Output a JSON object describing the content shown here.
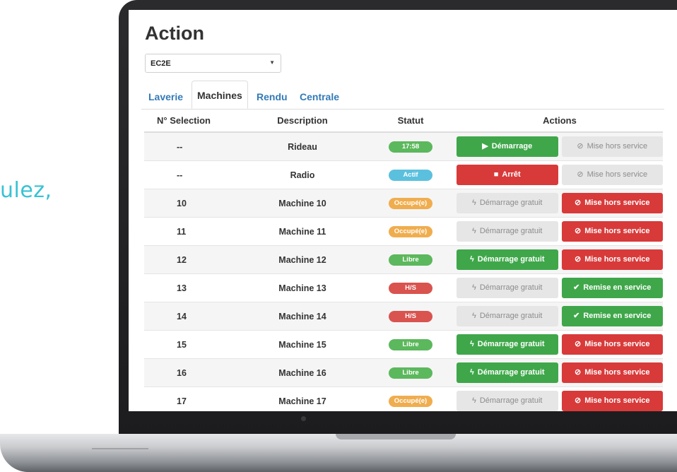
{
  "left_text": "ulez,",
  "page_title": "Action",
  "selector": {
    "value": "EC2E"
  },
  "tabs": [
    {
      "label": "Laverie",
      "active": false
    },
    {
      "label": "Machines",
      "active": true
    },
    {
      "label": "Rendu",
      "active": false
    },
    {
      "label": "Centrale",
      "active": false
    }
  ],
  "table": {
    "headers": [
      "N° Selection",
      "Description",
      "Statut",
      "Actions"
    ],
    "rows": [
      {
        "num": "--",
        "desc": "Rideau",
        "status": "17:58",
        "status_color": "green",
        "btn1": {
          "label": "Démarrage",
          "icon": "play-icon",
          "style": "success"
        },
        "btn2": {
          "label": "Mise hors service",
          "icon": "ban-icon",
          "style": "disabled"
        }
      },
      {
        "num": "--",
        "desc": "Radio",
        "status": "Actif",
        "status_color": "blue",
        "btn1": {
          "label": "Arrêt",
          "icon": "stop-icon",
          "style": "danger"
        },
        "btn2": {
          "label": "Mise hors service",
          "icon": "ban-icon",
          "style": "disabled"
        }
      },
      {
        "num": "10",
        "desc": "Machine 10",
        "status": "Occupé(e)",
        "status_color": "orange",
        "btn1": {
          "label": "Démarrage gratuit",
          "icon": "bolt-icon",
          "style": "disabled"
        },
        "btn2": {
          "label": "Mise hors service",
          "icon": "ban-icon",
          "style": "danger"
        }
      },
      {
        "num": "11",
        "desc": "Machine 11",
        "status": "Occupé(e)",
        "status_color": "orange",
        "btn1": {
          "label": "Démarrage gratuit",
          "icon": "bolt-icon",
          "style": "disabled"
        },
        "btn2": {
          "label": "Mise hors service",
          "icon": "ban-icon",
          "style": "danger"
        }
      },
      {
        "num": "12",
        "desc": "Machine 12",
        "status": "Libre",
        "status_color": "green",
        "btn1": {
          "label": "Démarrage gratuit",
          "icon": "bolt-icon",
          "style": "success"
        },
        "btn2": {
          "label": "Mise hors service",
          "icon": "ban-icon",
          "style": "danger"
        }
      },
      {
        "num": "13",
        "desc": "Machine 13",
        "status": "H/S",
        "status_color": "red",
        "btn1": {
          "label": "Démarrage gratuit",
          "icon": "bolt-icon",
          "style": "disabled"
        },
        "btn2": {
          "label": "Remise en service",
          "icon": "check-icon",
          "style": "success"
        }
      },
      {
        "num": "14",
        "desc": "Machine 14",
        "status": "H/S",
        "status_color": "red",
        "btn1": {
          "label": "Démarrage gratuit",
          "icon": "bolt-icon",
          "style": "disabled"
        },
        "btn2": {
          "label": "Remise en service",
          "icon": "check-icon",
          "style": "success"
        }
      },
      {
        "num": "15",
        "desc": "Machine 15",
        "status": "Libre",
        "status_color": "green",
        "btn1": {
          "label": "Démarrage gratuit",
          "icon": "bolt-icon",
          "style": "success"
        },
        "btn2": {
          "label": "Mise hors service",
          "icon": "ban-icon",
          "style": "danger"
        }
      },
      {
        "num": "16",
        "desc": "Machine 16",
        "status": "Libre",
        "status_color": "green",
        "btn1": {
          "label": "Démarrage gratuit",
          "icon": "bolt-icon",
          "style": "success"
        },
        "btn2": {
          "label": "Mise hors service",
          "icon": "ban-icon",
          "style": "danger"
        }
      },
      {
        "num": "17",
        "desc": "Machine 17",
        "status": "Occupé(e)",
        "status_color": "orange",
        "btn1": {
          "label": "Démarrage gratuit",
          "icon": "bolt-icon",
          "style": "disabled"
        },
        "btn2": {
          "label": "Mise hors service",
          "icon": "ban-icon",
          "style": "danger"
        }
      }
    ]
  },
  "colors": {
    "accent_text": "#38c2d4",
    "link": "#337ab7",
    "success": "#3fa74a",
    "danger": "#d83a3a",
    "disabled": "#e6e6e6"
  }
}
